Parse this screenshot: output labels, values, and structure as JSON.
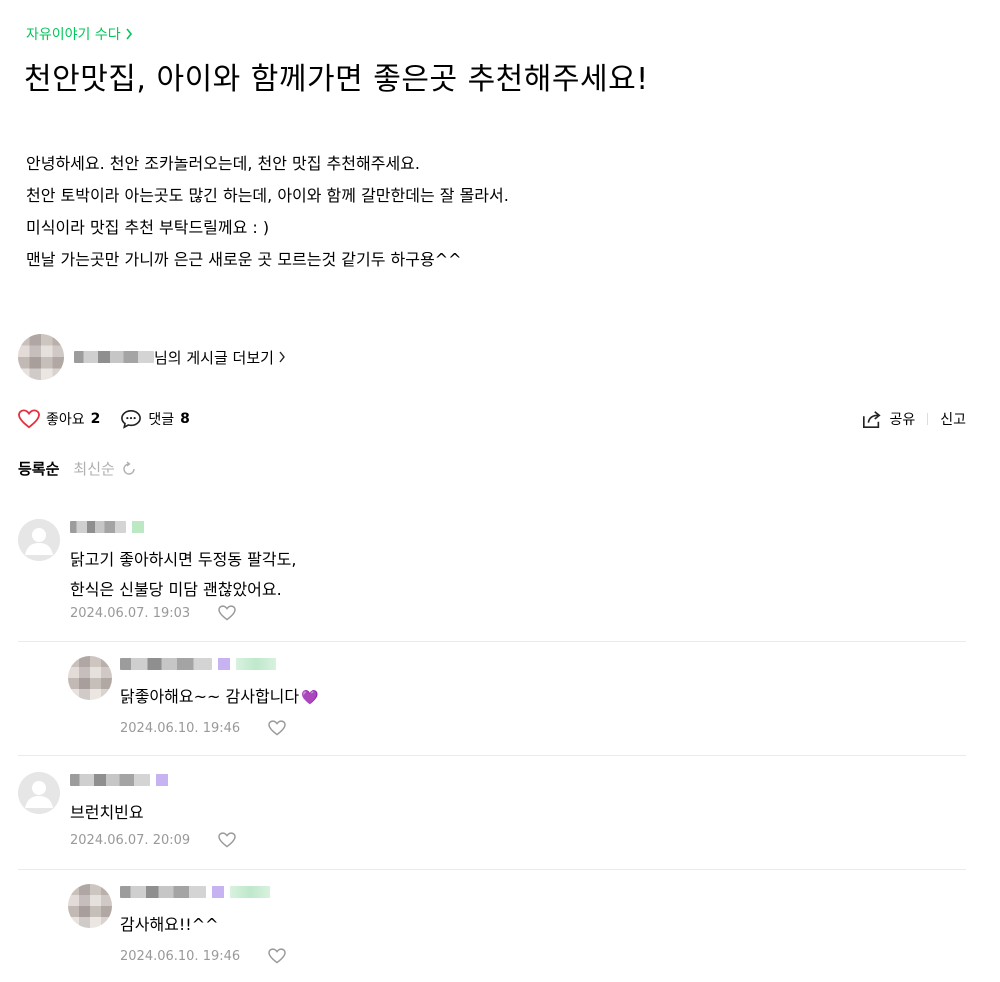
{
  "breadcrumb": {
    "label": "자유이야기 수다"
  },
  "post": {
    "title": "천안맛집, 아이와 함께가면 좋은곳 추천해주세요!",
    "body": [
      "안녕하세요. 천안 조카놀러오는데, 천안 맛집 추천해주세요.",
      "천안 토박이라 아는곳도 많긴 하는데, 아이와 함께 갈만한데는 잘 몰라서.",
      "미식이라 맛집 추천 부탁드릴께요 : )",
      "맨날 가는곳만 가니까 은근 새로운 곳 모르는것 같기두 하구용^^"
    ]
  },
  "author": {
    "more_label": "님의 게시글 더보기"
  },
  "actions": {
    "like_label": "좋아요",
    "like_count": "2",
    "comment_label": "댓글",
    "comment_count": "8",
    "share_label": "공유",
    "report_label": "신고",
    "like_color": "#e5303d"
  },
  "sort": {
    "active": "등록순",
    "inactive": "최신순"
  },
  "comments": [
    {
      "line1": "닭고기 좋아하시면 두정동 팔각도,",
      "line2": "한식은 신불당 미담 괜찮았어요.",
      "date": "2024.06.07. 19:03"
    },
    {
      "line1": "닭좋아해요~~ 감사합니다",
      "emoji": "💜",
      "date": "2024.06.10. 19:46"
    },
    {
      "line1": "브런치빈요",
      "date": "2024.06.07. 20:09"
    },
    {
      "line1": "감사해요!!^^",
      "date": "2024.06.10. 19:46"
    }
  ],
  "colors": {
    "accent": "#03c75a",
    "meta_gray": "#999999"
  }
}
